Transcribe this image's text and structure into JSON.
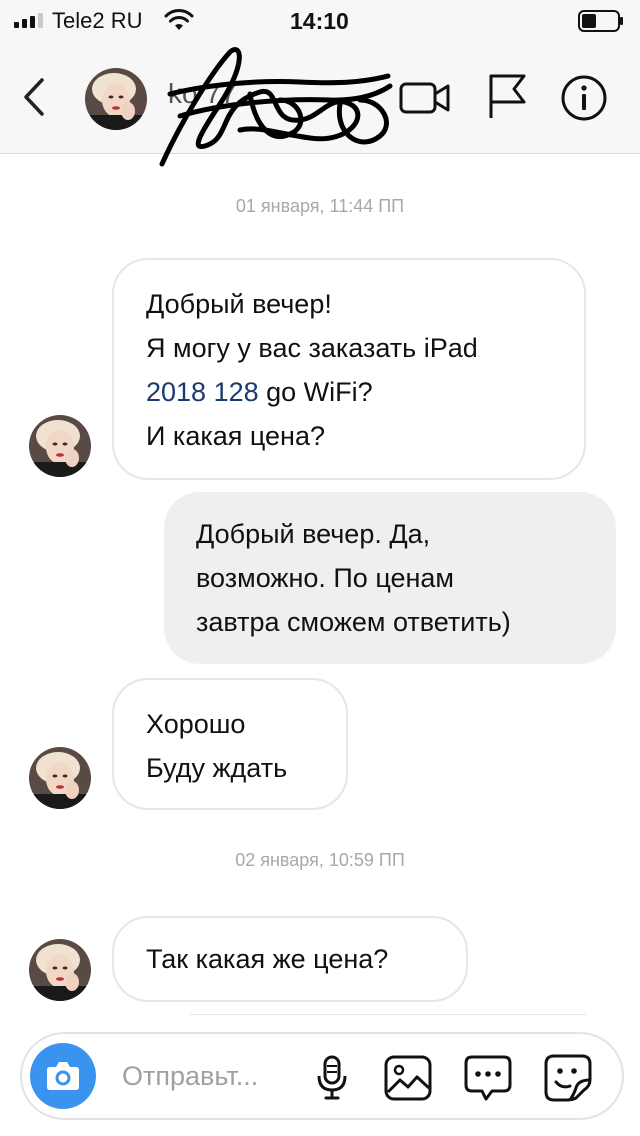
{
  "status_bar": {
    "carrier": "Tele2 RU",
    "time": "14:10"
  },
  "header": {
    "username": "ko 77"
  },
  "messages": [
    {
      "type": "timestamp",
      "text": "01 января, 11:44 ПП"
    },
    {
      "type": "incoming",
      "lines": [
        "Добрый вечер!",
        "Я могу у вас заказать iPad",
        "2018 128",
        "go WiFi?",
        "И какая цена?"
      ]
    },
    {
      "type": "outgoing",
      "lines": [
        "Добрый вечер. Да,",
        "возможно. По ценам",
        "завтра сможем ответить)"
      ]
    },
    {
      "type": "incoming",
      "lines": [
        "Хорошо",
        "Буду ждать"
      ]
    },
    {
      "type": "timestamp",
      "text": "02 января, 10:59 ПП"
    },
    {
      "type": "incoming",
      "lines": [
        "Так какая же цена?"
      ]
    }
  ],
  "composer": {
    "placeholder": "Отправьт..."
  },
  "colors": {
    "accent": "#3b93f0",
    "link": "#1b3a6e",
    "outgoing_bubble": "#efefef"
  }
}
